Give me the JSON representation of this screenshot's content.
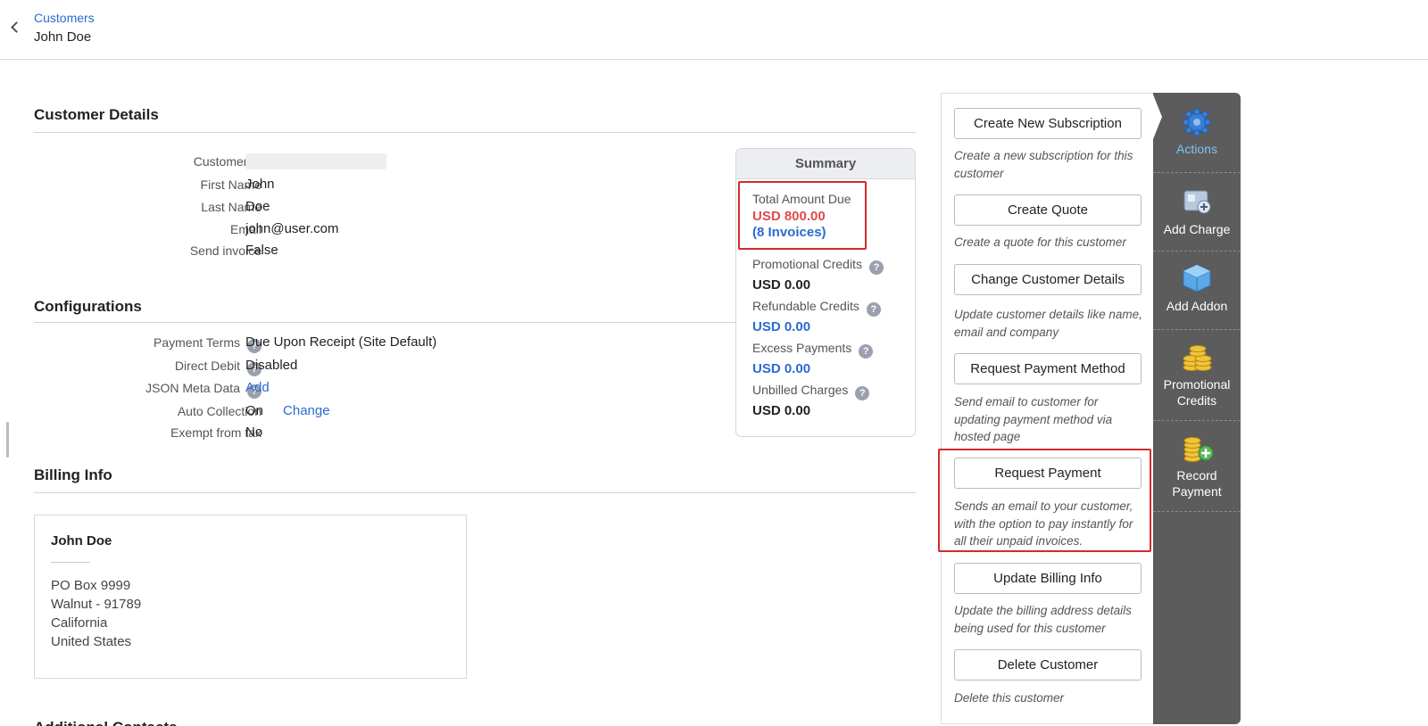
{
  "breadcrumb": {
    "parent": "Customers",
    "current": "John Doe"
  },
  "customer_details": {
    "title": "Customer Details",
    "fields": [
      {
        "label": "Customer Id",
        "value": ""
      },
      {
        "label": "First Name",
        "value": "John"
      },
      {
        "label": "Last Name",
        "value": "Doe"
      },
      {
        "label": "Email",
        "value": "john@user.com"
      },
      {
        "label": "Send invoice",
        "value": "False"
      }
    ]
  },
  "configurations": {
    "title": "Configurations",
    "payment_terms": {
      "label": "Payment Terms",
      "value": "Due Upon Receipt (Site Default)"
    },
    "direct_debit": {
      "label": "Direct Debit",
      "value": "Disabled"
    },
    "json_meta": {
      "label": "JSON Meta Data",
      "action": "Add"
    },
    "auto_collection": {
      "label": "Auto Collection",
      "value": "On",
      "action": "Change"
    },
    "exempt_tax": {
      "label": "Exempt from tax",
      "value": "No"
    }
  },
  "billing_info": {
    "title": "Billing Info",
    "name": "John Doe",
    "address_lines": [
      "PO Box 9999",
      "Walnut - 91789",
      "California",
      "United States"
    ]
  },
  "additional_contacts_title": "Additional Contacts",
  "summary": {
    "title": "Summary",
    "total_due": {
      "label": "Total Amount Due",
      "value": "USD 800.00",
      "invoices": "(8 Invoices)"
    },
    "promotional_credits": {
      "label": "Promotional Credits",
      "value": "USD 0.00"
    },
    "refundable_credits": {
      "label": "Refundable Credits",
      "value": "USD 0.00"
    },
    "excess_payments": {
      "label": "Excess Payments",
      "value": "USD 0.00"
    },
    "unbilled_charges": {
      "label": "Unbilled Charges",
      "value": "USD 0.00"
    }
  },
  "actions": [
    {
      "label": "Create New Subscription",
      "desc": "Create a new subscription for this customer"
    },
    {
      "label": "Create Quote",
      "desc": "Create a quote for this customer"
    },
    {
      "label": "Change Customer Details",
      "desc": "Update customer details like name, email and company"
    },
    {
      "label": "Request Payment Method",
      "desc": "Send email to customer for updating payment method via hosted page"
    },
    {
      "label": "Request Payment",
      "desc": "Sends an email to your customer, with the option to pay instantly for all their unpaid invoices."
    },
    {
      "label": "Update Billing Info",
      "desc": "Update the billing address details being used for this customer"
    },
    {
      "label": "Delete Customer",
      "desc": "Delete this customer"
    }
  ],
  "sidebar": [
    {
      "label": "Actions",
      "icon": "gear-icon"
    },
    {
      "label": "Add Charge",
      "icon": "add-charge-icon"
    },
    {
      "label": "Add Addon",
      "icon": "cube-icon"
    },
    {
      "label": "Promotional Credits",
      "icon": "coins-icon"
    },
    {
      "label": "Record Payment",
      "icon": "coins-plus-icon"
    }
  ],
  "help_glyph": "?",
  "colors": {
    "accent": "#2a6bd1",
    "amount_due": "#e04a4a",
    "highlight": "#d52a2a",
    "sidebar": "#5c5c5c",
    "sidebar_active": "#7fc3f5"
  }
}
